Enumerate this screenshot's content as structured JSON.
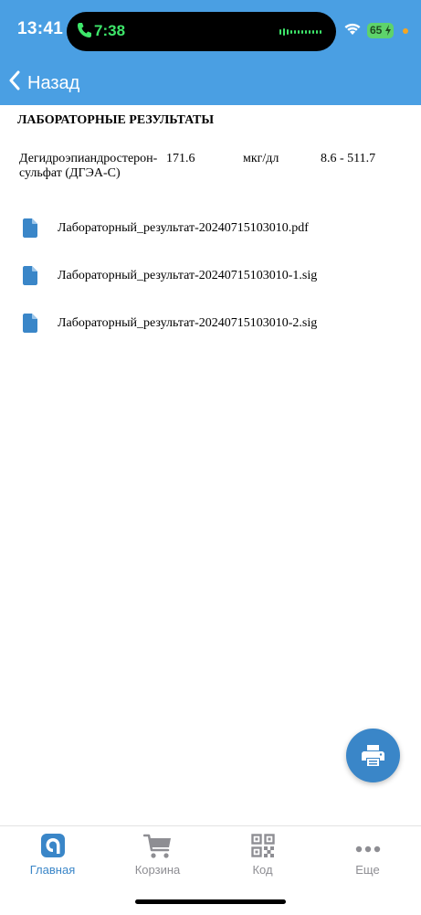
{
  "status_bar": {
    "time": "13:41",
    "call_time": "7:38",
    "battery": "65"
  },
  "nav": {
    "back_label": "Назад"
  },
  "content": {
    "title": "ЛАБОРАТОРНЫЕ РЕЗУЛЬТАТЫ",
    "results": [
      {
        "name": "Дегидроэпиандростерон-сульфат (ДГЭА-С)",
        "value": "171.6",
        "unit": "мкг/дл",
        "range": "8.6 - 511.7"
      }
    ],
    "files": [
      {
        "name": "Лабораторный_результат-20240715103010.pdf"
      },
      {
        "name": "Лабораторный_результат-20240715103010-1.sig"
      },
      {
        "name": "Лабораторный_результат-20240715103010-2.sig"
      }
    ]
  },
  "tabs": [
    {
      "label": "Главная",
      "icon": "home-logo-icon",
      "active": true
    },
    {
      "label": "Корзина",
      "icon": "cart-icon",
      "active": false
    },
    {
      "label": "Код",
      "icon": "qr-code-icon",
      "active": false
    },
    {
      "label": "Еще",
      "icon": "more-dots-icon",
      "active": false
    }
  ],
  "colors": {
    "header": "#4a9fe3",
    "accent": "#3a86c8",
    "inactive": "#8e8e93"
  }
}
